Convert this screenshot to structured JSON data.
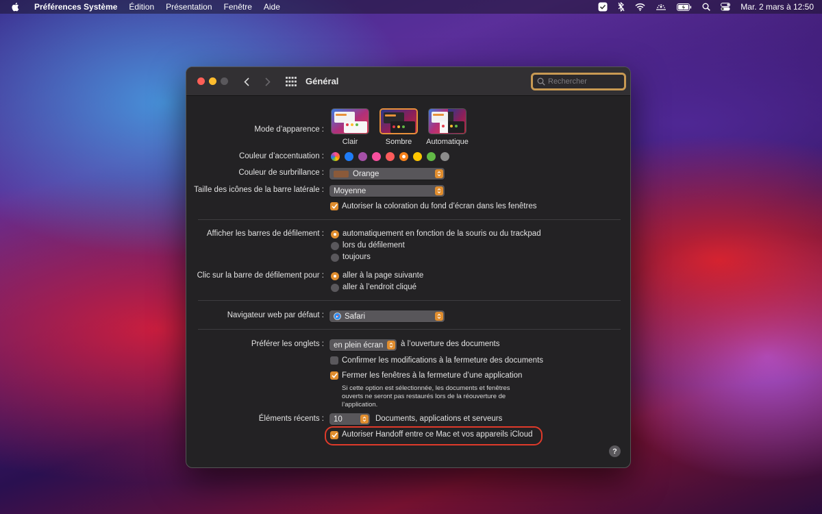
{
  "menubar": {
    "app_name": "Préférences Système",
    "items": [
      "Édition",
      "Présentation",
      "Fenêtre",
      "Aide"
    ],
    "clock": "Mar. 2 mars à  12:50"
  },
  "window": {
    "title": "Général",
    "search_placeholder": "Rechercher"
  },
  "appearance": {
    "label": "Mode d’apparence :",
    "options": [
      "Clair",
      "Sombre",
      "Automatique"
    ],
    "selected": "Sombre"
  },
  "accent": {
    "label": "Couleur d’accentuation :",
    "colors": [
      "multicolor",
      "#1f7cf6",
      "#a550a7",
      "#f74f9e",
      "#fc5b5b",
      "#f7821b",
      "#ffc600",
      "#62ba46",
      "#8c8c8c"
    ],
    "selected_index": 5
  },
  "highlight_color": {
    "label": "Couleur de surbrillance :",
    "value": "Orange",
    "swatch": "#8a5a3a"
  },
  "sidebar_icon_size": {
    "label": "Taille des icônes de la barre latérale :",
    "value": "Moyenne"
  },
  "wallpaper_tinting": {
    "label": "Autoriser la coloration du fond d’écran dans les fenêtres",
    "checked": true
  },
  "scrollbars": {
    "label": "Afficher les barres de défilement :",
    "options": [
      "automatiquement en fonction de la souris ou du trackpad",
      "lors du défilement",
      "toujours"
    ],
    "selected_index": 0
  },
  "scroll_click": {
    "label": "Clic sur la barre de défilement pour :",
    "options": [
      "aller à la page suivante",
      "aller à l’endroit cliqué"
    ],
    "selected_index": 0
  },
  "browser": {
    "label": "Navigateur web par défaut :",
    "value": "Safari"
  },
  "tabs": {
    "label": "Préférer les onglets :",
    "value": "en plein écran",
    "suffix": "à l’ouverture des documents"
  },
  "confirm_changes": {
    "label": "Confirmer les modifications à la fermeture des documents",
    "checked": false
  },
  "close_windows": {
    "label": "Fermer les fenêtres à la fermeture d’une application",
    "checked": true,
    "note": "Si cette option est sélectionnée, les documents et fenêtres ouverts ne seront pas restaurés lors de la réouverture de l’application."
  },
  "recent_items": {
    "label": "Éléments récents :",
    "value": "10",
    "suffix": "Documents, applications et serveurs"
  },
  "handoff": {
    "label": "Autoriser Handoff entre ce Mac et vos appareils iCloud",
    "checked": true
  },
  "help_label": "?"
}
